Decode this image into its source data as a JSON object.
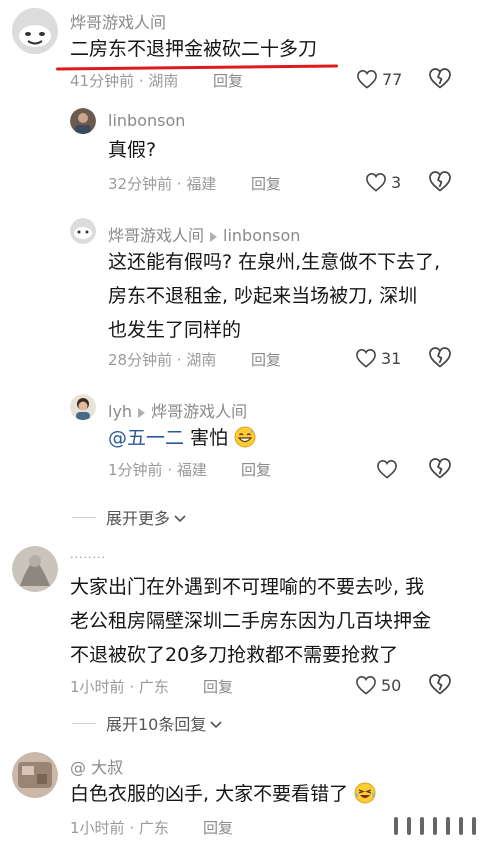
{
  "comments": [
    {
      "user": "烨哥游戏人间",
      "text": "二房东不退押金被砍二十多刀",
      "time": "41分钟前",
      "location": "湖南",
      "reply_label": "回复",
      "likes": "77",
      "highlight_color": "#e0191f",
      "replies": [
        {
          "user": "linbonson",
          "text": "真假?",
          "time": "32分钟前",
          "location": "福建",
          "reply_label": "回复",
          "likes": "3"
        },
        {
          "user": "烨哥游戏人间",
          "reply_to": "linbonson",
          "lines": [
            "这还能有假吗? 在泉州,生意做不下去了,",
            "房东不退租金, 吵起来当场被刀, 深圳",
            "也发生了同样的"
          ],
          "time": "28分钟前",
          "location": "湖南",
          "reply_label": "回复",
          "likes": "31"
        },
        {
          "user": "lyh",
          "reply_to": "烨哥游戏人间",
          "mention": "@五一二",
          "text": " 害怕",
          "emoji": "grinning-sweat-emoji",
          "time": "1分钟前",
          "location": "福建",
          "reply_label": "回复",
          "likes": ""
        }
      ],
      "expand_label": "展开更多"
    },
    {
      "user": "........",
      "lines": [
        "大家出门在外遇到不可理喻的不要去吵, 我",
        "老公租房隔壁深圳二手房东因为几百块押金",
        "不退被砍了20多刀抢救都不需要抢救了"
      ],
      "time": "1小时前",
      "location": "广东",
      "reply_label": "回复",
      "likes": "50",
      "expand_label": "展开10条回复"
    },
    {
      "user": "@ 大叔",
      "text": "白色衣服的凶手, 大家不要看错了",
      "emoji": "crying-laughing-emoji",
      "time": "1小时前",
      "location": "广东",
      "reply_label": "回复"
    }
  ],
  "separator": " · ",
  "watermark_icon": "bars-icon"
}
